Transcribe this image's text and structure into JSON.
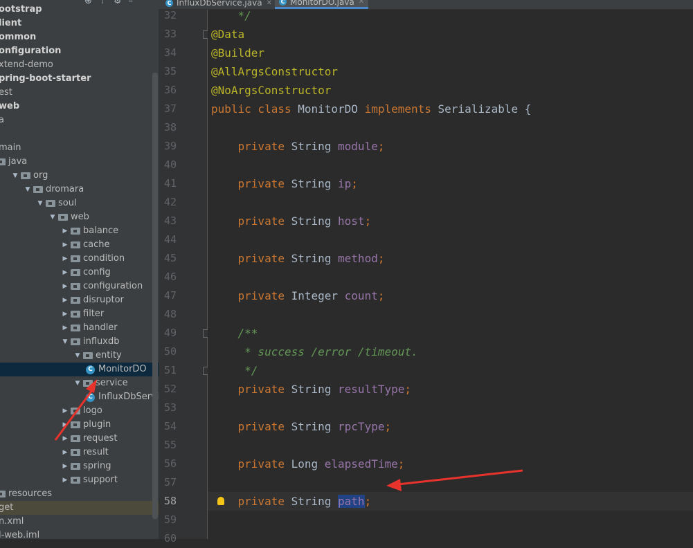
{
  "project_tree": {
    "items": [
      {
        "label": "ootstrap",
        "style": "bold",
        "indent": 0
      },
      {
        "label": "lient",
        "style": "bold",
        "indent": 0
      },
      {
        "label": "ommon",
        "style": "bold",
        "indent": 0
      },
      {
        "label": "onfiguration",
        "style": "bold",
        "indent": 0
      },
      {
        "label": "xtend-demo",
        "style": "normal",
        "indent": 0
      },
      {
        "label": "pring-boot-starter",
        "style": "bold",
        "indent": 0
      },
      {
        "label": "est",
        "style": "normal",
        "indent": 0
      },
      {
        "label": "web",
        "style": "bold",
        "indent": 0
      },
      {
        "label": "a",
        "style": "normal",
        "indent": 0
      },
      {
        "label": "",
        "style": "normal",
        "indent": 0
      },
      {
        "label": "main",
        "style": "normal",
        "indent": 0
      },
      {
        "label": "java",
        "style": "normal",
        "icon": "folder",
        "indent": 0
      },
      {
        "label": "org",
        "style": "normal",
        "icon": "folder",
        "arrow": "down",
        "indent": 1
      },
      {
        "label": "dromara",
        "style": "normal",
        "icon": "folder",
        "arrow": "down",
        "indent": 2
      },
      {
        "label": "soul",
        "style": "normal",
        "icon": "folder",
        "arrow": "down",
        "indent": 3
      },
      {
        "label": "web",
        "style": "normal",
        "icon": "folder",
        "arrow": "down",
        "indent": 4
      },
      {
        "label": "balance",
        "style": "normal",
        "icon": "folder",
        "arrow": "right",
        "indent": 5
      },
      {
        "label": "cache",
        "style": "normal",
        "icon": "folder",
        "arrow": "right",
        "indent": 5
      },
      {
        "label": "condition",
        "style": "normal",
        "icon": "folder",
        "arrow": "right",
        "indent": 5
      },
      {
        "label": "config",
        "style": "normal",
        "icon": "folder",
        "arrow": "right",
        "indent": 5
      },
      {
        "label": "configuration",
        "style": "normal",
        "icon": "folder",
        "arrow": "right",
        "indent": 5
      },
      {
        "label": "disruptor",
        "style": "normal",
        "icon": "folder",
        "arrow": "right",
        "indent": 5
      },
      {
        "label": "filter",
        "style": "normal",
        "icon": "folder",
        "arrow": "right",
        "indent": 5
      },
      {
        "label": "handler",
        "style": "normal",
        "icon": "folder",
        "arrow": "right",
        "indent": 5
      },
      {
        "label": "influxdb",
        "style": "normal",
        "icon": "folder",
        "arrow": "down",
        "indent": 5
      },
      {
        "label": "entity",
        "style": "normal",
        "icon": "folder",
        "arrow": "down",
        "indent": 6
      },
      {
        "label": "MonitorDO",
        "style": "selected",
        "icon": "class",
        "indent": 7
      },
      {
        "label": "service",
        "style": "normal",
        "icon": "folder",
        "arrow": "down",
        "indent": 6
      },
      {
        "label": "InfluxDbService",
        "style": "normal",
        "icon": "class",
        "indent": 7
      },
      {
        "label": "logo",
        "style": "normal",
        "icon": "folder",
        "arrow": "right",
        "indent": 5
      },
      {
        "label": "plugin",
        "style": "normal",
        "icon": "folder",
        "arrow": "right",
        "indent": 5
      },
      {
        "label": "request",
        "style": "normal",
        "icon": "folder",
        "arrow": "right",
        "indent": 5
      },
      {
        "label": "result",
        "style": "normal",
        "icon": "folder",
        "arrow": "right",
        "indent": 5
      },
      {
        "label": "spring",
        "style": "normal",
        "icon": "folder",
        "arrow": "right",
        "indent": 5
      },
      {
        "label": "support",
        "style": "normal",
        "icon": "folder",
        "arrow": "right",
        "indent": 5
      },
      {
        "label": "resources",
        "style": "normal",
        "icon": "folder",
        "indent": 0
      },
      {
        "label": "get",
        "style": "target",
        "indent": 0
      },
      {
        "label": "n.xml",
        "style": "normal",
        "indent": 0
      },
      {
        "label": "l-web.iml",
        "style": "normal",
        "indent": 0
      }
    ]
  },
  "tabs": [
    {
      "label": "InfluxDbService.java",
      "active": false
    },
    {
      "label": "MonitorDO.java",
      "active": true
    }
  ],
  "toolbar_icons": [
    "target-icon",
    "collapse-icon",
    "gear-icon",
    "minimize-icon"
  ],
  "editor": {
    "first_line_number": 32,
    "current_line": 58,
    "highlighted_identifier": "path",
    "lines": [
      [
        {
          "t": "    */",
          "c": "cm"
        }
      ],
      [
        {
          "t": "@Data",
          "c": "an"
        }
      ],
      [
        {
          "t": "@Builder",
          "c": "an"
        }
      ],
      [
        {
          "t": "@AllArgsConstructor",
          "c": "an"
        }
      ],
      [
        {
          "t": "@NoArgsConstructor",
          "c": "an"
        }
      ],
      [
        {
          "t": "public class ",
          "c": "kw"
        },
        {
          "t": "MonitorDO ",
          "c": ""
        },
        {
          "t": "implements ",
          "c": "kw"
        },
        {
          "t": "Serializable {",
          "c": ""
        }
      ],
      [],
      [
        {
          "t": "    private ",
          "c": "kw"
        },
        {
          "t": "String ",
          "c": ""
        },
        {
          "t": "module",
          "c": "fd"
        },
        {
          "t": ";",
          "c": "kw"
        }
      ],
      [],
      [
        {
          "t": "    private ",
          "c": "kw"
        },
        {
          "t": "String ",
          "c": ""
        },
        {
          "t": "ip",
          "c": "fd"
        },
        {
          "t": ";",
          "c": "kw"
        }
      ],
      [],
      [
        {
          "t": "    private ",
          "c": "kw"
        },
        {
          "t": "String ",
          "c": ""
        },
        {
          "t": "host",
          "c": "fd"
        },
        {
          "t": ";",
          "c": "kw"
        }
      ],
      [],
      [
        {
          "t": "    private ",
          "c": "kw"
        },
        {
          "t": "String ",
          "c": ""
        },
        {
          "t": "method",
          "c": "fd"
        },
        {
          "t": ";",
          "c": "kw"
        }
      ],
      [],
      [
        {
          "t": "    private ",
          "c": "kw"
        },
        {
          "t": "Integer ",
          "c": ""
        },
        {
          "t": "count",
          "c": "fd"
        },
        {
          "t": ";",
          "c": "kw"
        }
      ],
      [],
      [
        {
          "t": "    /**",
          "c": "cm"
        }
      ],
      [
        {
          "t": "     * success /error /timeout.",
          "c": "cm"
        }
      ],
      [
        {
          "t": "     */",
          "c": "cm"
        }
      ],
      [
        {
          "t": "    private ",
          "c": "kw"
        },
        {
          "t": "String ",
          "c": ""
        },
        {
          "t": "resultType",
          "c": "fd"
        },
        {
          "t": ";",
          "c": "kw"
        }
      ],
      [],
      [
        {
          "t": "    private ",
          "c": "kw"
        },
        {
          "t": "String ",
          "c": ""
        },
        {
          "t": "rpcType",
          "c": "fd"
        },
        {
          "t": ";",
          "c": "kw"
        }
      ],
      [],
      [
        {
          "t": "    private ",
          "c": "kw"
        },
        {
          "t": "Long ",
          "c": ""
        },
        {
          "t": "elapsedTime",
          "c": "fd"
        },
        {
          "t": ";",
          "c": "kw"
        }
      ],
      [],
      [
        {
          "t": "    private ",
          "c": "kw"
        },
        {
          "t": "String ",
          "c": ""
        },
        {
          "t": "path",
          "c": "fd hl"
        },
        {
          "t": ";",
          "c": "kw"
        }
      ],
      [],
      []
    ]
  },
  "colors": {
    "annotation_arrow": "#e8322c",
    "keyword": "#cc7832",
    "annotation": "#bbb529",
    "field": "#9876aa",
    "comment": "#629755"
  }
}
